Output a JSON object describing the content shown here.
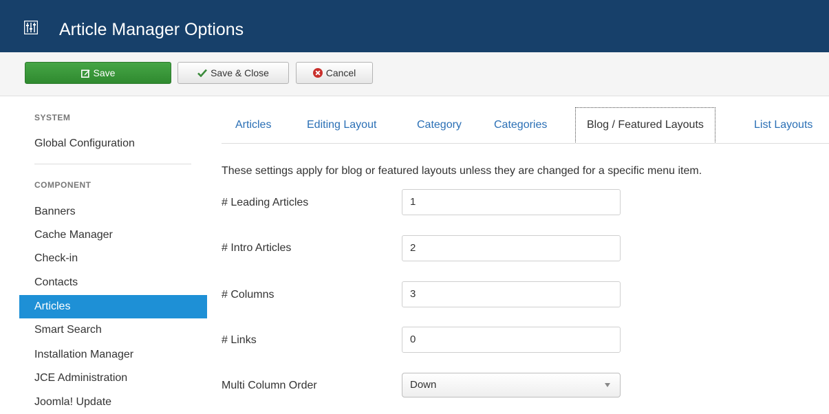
{
  "header": {
    "title": "Article Manager Options",
    "icon": "options-icon"
  },
  "toolbar": {
    "save_label": "Save",
    "save_close_label": "Save & Close",
    "cancel_label": "Cancel"
  },
  "sidebar": {
    "system_heading": "SYSTEM",
    "system_items": [
      "Global Configuration"
    ],
    "component_heading": "COMPONENT",
    "items": [
      {
        "label": "Banners"
      },
      {
        "label": "Cache Manager"
      },
      {
        "label": "Check-in"
      },
      {
        "label": "Contacts"
      },
      {
        "label": "Articles",
        "active": true
      },
      {
        "label": "Smart Search"
      },
      {
        "label": "Installation Manager"
      },
      {
        "label": "JCE Administration"
      },
      {
        "label": "Joomla! Update"
      }
    ]
  },
  "tabs": [
    {
      "label": "Articles"
    },
    {
      "label": "Editing Layout"
    },
    {
      "label": "Category"
    },
    {
      "label": "Categories"
    },
    {
      "label": "Blog / Featured Layouts",
      "active": true
    },
    {
      "label": "List Layouts"
    }
  ],
  "content": {
    "description": "These settings apply for blog or featured layouts unless they are changed for a specific menu item.",
    "fields": [
      {
        "label": "# Leading Articles",
        "value": "1"
      },
      {
        "label": "# Intro Articles",
        "value": "2"
      },
      {
        "label": "# Columns",
        "value": "3"
      },
      {
        "label": "# Links",
        "value": "0"
      }
    ],
    "multi_column_order": {
      "label": "Multi Column Order",
      "value": "Down"
    }
  },
  "colors": {
    "header_bg": "#17406a",
    "save_green": "#46a546",
    "active_item": "#1e90d6",
    "link_blue": "#2a6fb5"
  }
}
